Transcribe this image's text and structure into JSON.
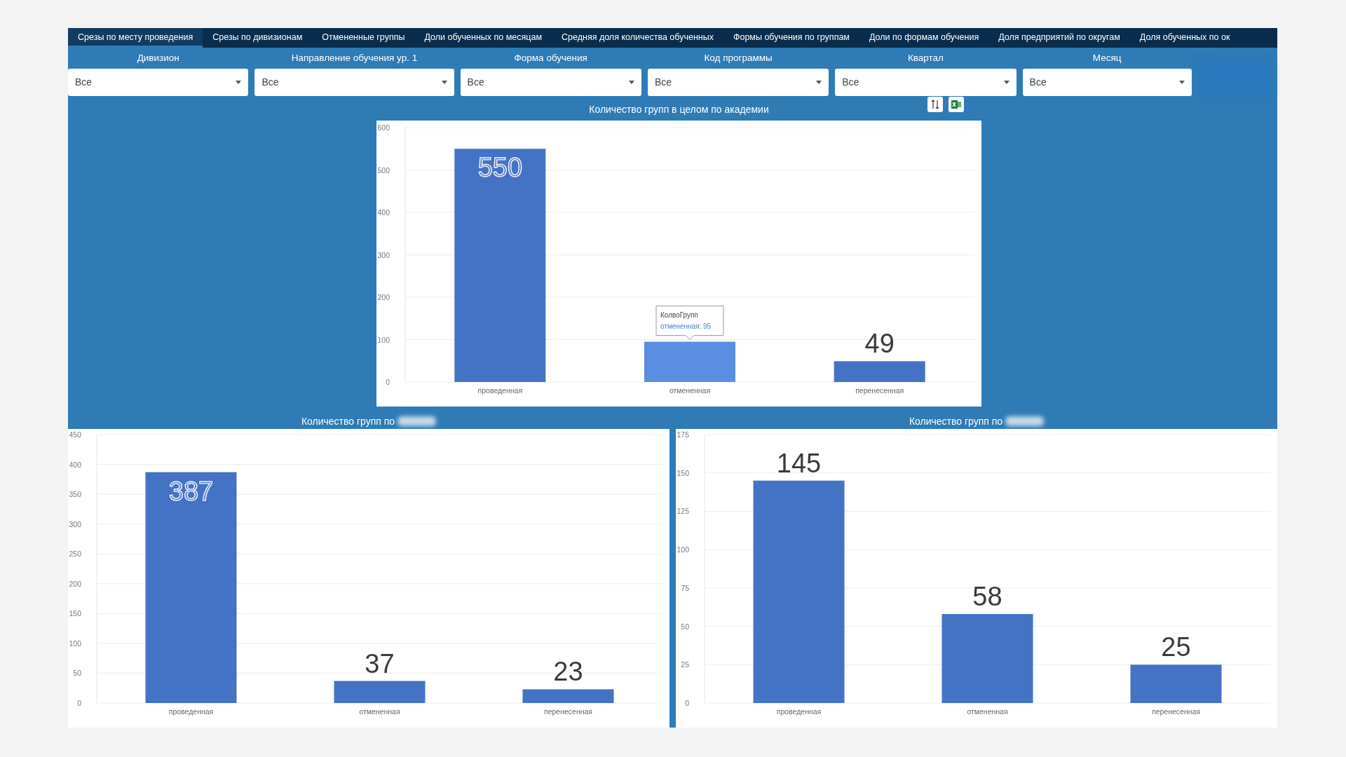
{
  "tabs": [
    {
      "label": "Срезы по месту проведения",
      "selected": true
    },
    {
      "label": "Срезы по дивизионам",
      "selected": false
    },
    {
      "label": "Отмененные группы",
      "selected": false
    },
    {
      "label": "Доли обученных по месяцам",
      "selected": false
    },
    {
      "label": "Средняя доля количества обученных",
      "selected": false
    },
    {
      "label": "Формы обучения по группам",
      "selected": false
    },
    {
      "label": "Доли по формам обучения",
      "selected": false
    },
    {
      "label": "Доля предприятий по округам",
      "selected": false
    },
    {
      "label": "Доля обученных по ок",
      "selected": false
    }
  ],
  "filters": [
    {
      "label": "Дивизион",
      "value": "Все"
    },
    {
      "label": "Направление обучения ур. 1",
      "value": "Все"
    },
    {
      "label": "Форма обучения",
      "value": "Все"
    },
    {
      "label": "Код программы",
      "value": "Все"
    },
    {
      "label": "Квартал",
      "value": "Все"
    },
    {
      "label": "Месяц",
      "value": "Все"
    }
  ],
  "charts": [
    {
      "title": "Количество групп в целом по академии",
      "chart_data": {
        "type": "bar",
        "categories": [
          "проведенная",
          "отмененная",
          "перенесенная"
        ],
        "values": [
          550,
          95,
          49
        ],
        "ylim": [
          0,
          600
        ],
        "yticks": [
          0,
          100,
          200,
          300,
          400,
          500,
          600
        ],
        "value_labels": [
          "550",
          null,
          "49"
        ],
        "grid": true
      },
      "hovered": [
        false,
        true,
        false
      ],
      "tooltip": {
        "title": "КолвоГрупп",
        "text": "отмененная: 95"
      }
    },
    {
      "title": "Количество групп по",
      "title_blurred": true,
      "chart_data": {
        "type": "bar",
        "categories": [
          "проведенная",
          "отмененная",
          "перенесенная"
        ],
        "values": [
          387,
          37,
          23
        ],
        "ylim": [
          0,
          450
        ],
        "yticks": [
          0,
          50,
          100,
          150,
          200,
          250,
          300,
          350,
          400,
          450
        ],
        "data_labels": true,
        "grid": true
      },
      "hovered": [
        false,
        false,
        false
      ]
    },
    {
      "title": "Количество групп по",
      "title_blurred": true,
      "chart_data": {
        "type": "bar",
        "categories": [
          "проведенная",
          "отмененная",
          "перенесенная"
        ],
        "values": [
          145,
          58,
          25
        ],
        "ylim": [
          0,
          175
        ],
        "yticks": [
          0,
          25,
          50,
          75,
          100,
          125,
          150,
          175
        ],
        "data_labels": true,
        "grid": true
      },
      "hovered": [
        false,
        false,
        false
      ]
    }
  ]
}
